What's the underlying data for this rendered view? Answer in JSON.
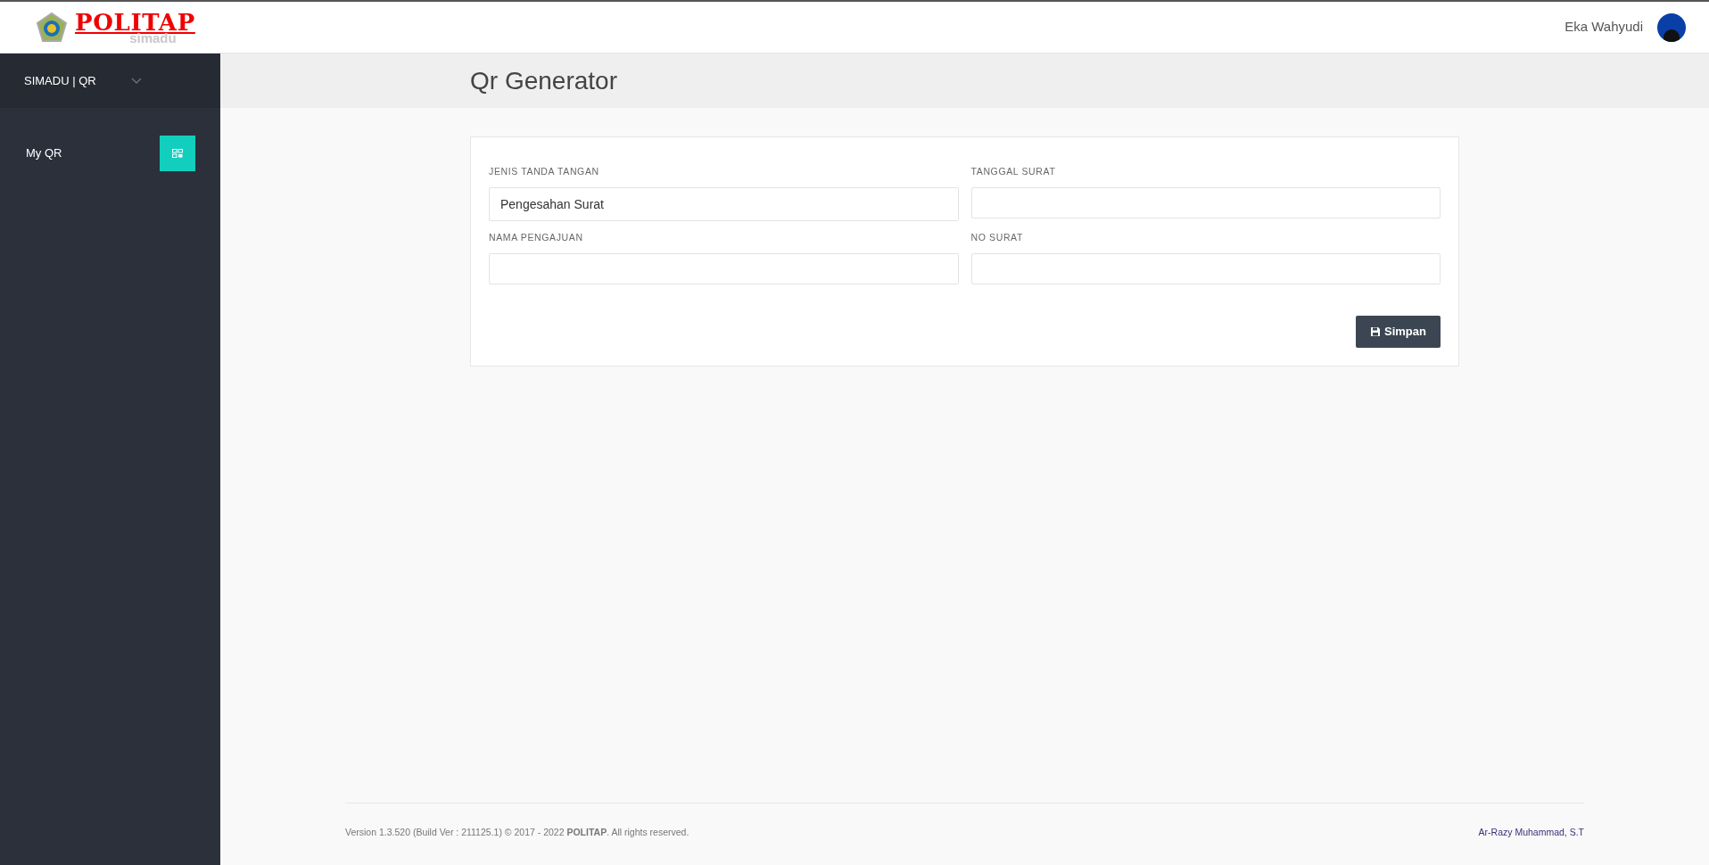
{
  "header": {
    "logo_text": "POLITAP",
    "logo_subtext": "simadu",
    "user_name": "Eka Wahyudi"
  },
  "sidebar": {
    "title": "SIMADU | QR",
    "expanded": false,
    "items": [
      {
        "label": "My QR",
        "selected": true
      }
    ]
  },
  "page": {
    "title": "Qr Generator"
  },
  "form": {
    "fields": [
      {
        "label": "JENIS TANDA TANGAN",
        "value": "Pengesahan Surat"
      },
      {
        "label": "TANGGAL SURAT"
      },
      {
        "label": "NAMA PENGAJUAN"
      },
      {
        "label": "NO SURAT"
      }
    ],
    "submit": "Simpan"
  },
  "footer": {
    "version": "Version 1.3.520 (Build Ver : 211125.1) © 2017 - 2022 **POLITAP**. All rights reserved.",
    "author": "Ar-Razy Muhammad, S.T"
  }
}
